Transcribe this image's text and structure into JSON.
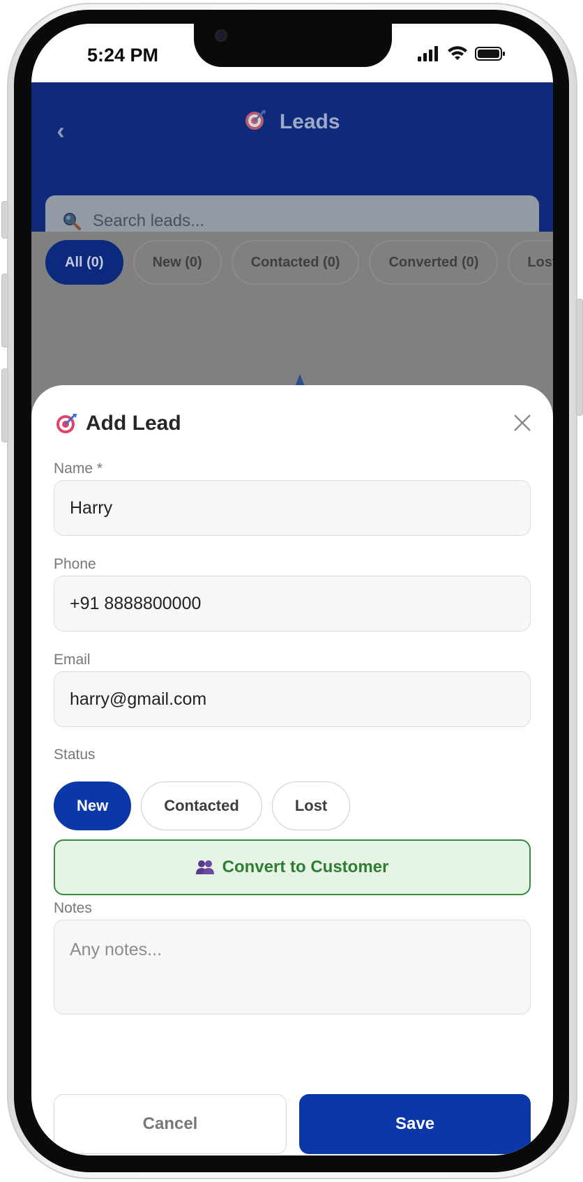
{
  "status_bar": {
    "time": "5:24 PM",
    "icons": [
      "signal-icon",
      "wifi-icon",
      "battery-icon"
    ]
  },
  "header": {
    "title": "Leads",
    "icon": "target-icon",
    "back_icon": "back-chevron-icon"
  },
  "search": {
    "placeholder": "Search leads..."
  },
  "filters": [
    {
      "label": "All (0)",
      "active": true
    },
    {
      "label": "New (0)",
      "active": false
    },
    {
      "label": "Contacted (0)",
      "active": false
    },
    {
      "label": "Converted (0)",
      "active": false
    },
    {
      "label": "Lost (",
      "active": false
    }
  ],
  "sheet": {
    "title": "Add Lead",
    "name_label": "Name *",
    "name_value": "Harry",
    "phone_label": "Phone",
    "phone_value": "+91 8888800000",
    "email_label": "Email",
    "email_value": "harry@gmail.com",
    "status_label": "Status",
    "status_options": [
      "New",
      "Contacted",
      "Lost"
    ],
    "status_selected": "New",
    "convert_label": "Convert to Customer",
    "notes_label": "Notes",
    "notes_placeholder": "Any notes...",
    "cancel_label": "Cancel",
    "save_label": "Save"
  },
  "colors": {
    "primary": "#0b37a8",
    "header_bg": "#0f2a7a",
    "convert_green": "#2e7d32",
    "convert_bg": "#e6f4e6"
  }
}
